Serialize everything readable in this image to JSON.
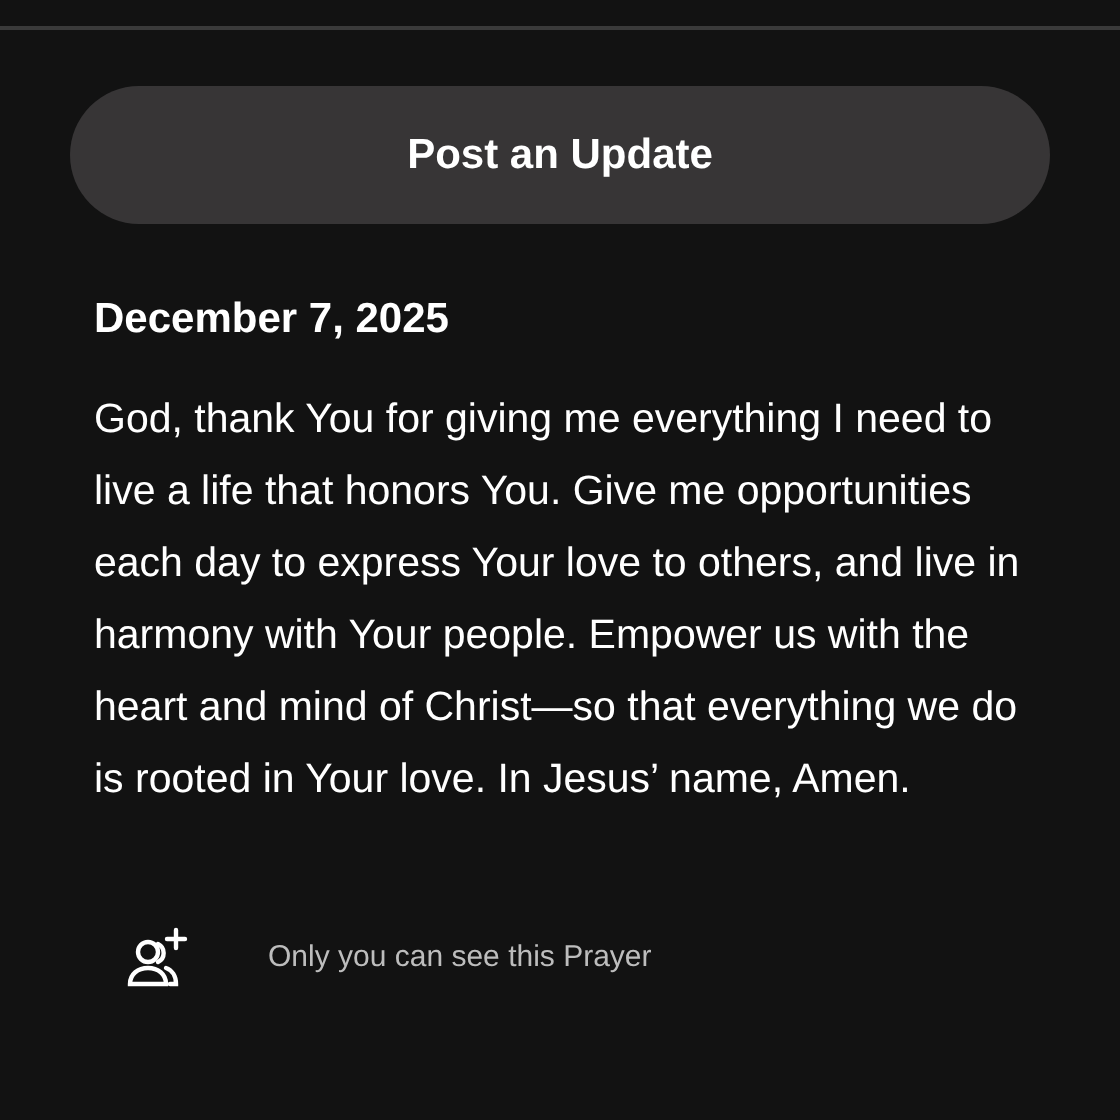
{
  "post_button": {
    "label": "Post an Update"
  },
  "entry": {
    "date": "December 7, 2025",
    "text": "God, thank You for giving me everything I need to live a life that honors You. Give me opportunities each day to express Your love to others, and live in harmony with Your people. Empower us with the heart and mind of Christ—so that everything we do is rooted in Your love. In Jesus’ name, Amen."
  },
  "visibility": {
    "text": "Only you can see this Prayer"
  }
}
